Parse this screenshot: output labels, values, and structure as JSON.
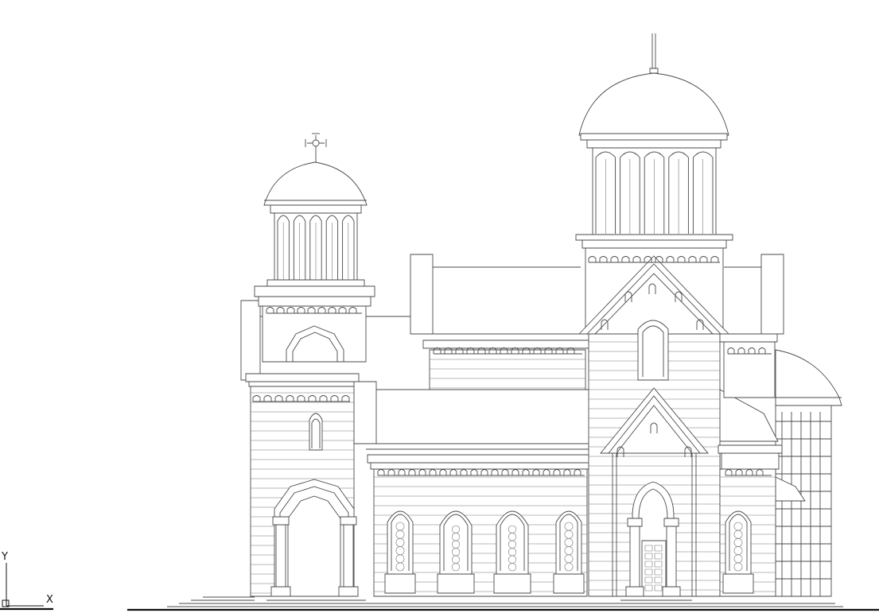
{
  "ucs": {
    "x_label": "X",
    "y_label": "Y"
  },
  "colors": {
    "line": "#4a4a4a",
    "background": "#ffffff",
    "ground": "#111111"
  }
}
